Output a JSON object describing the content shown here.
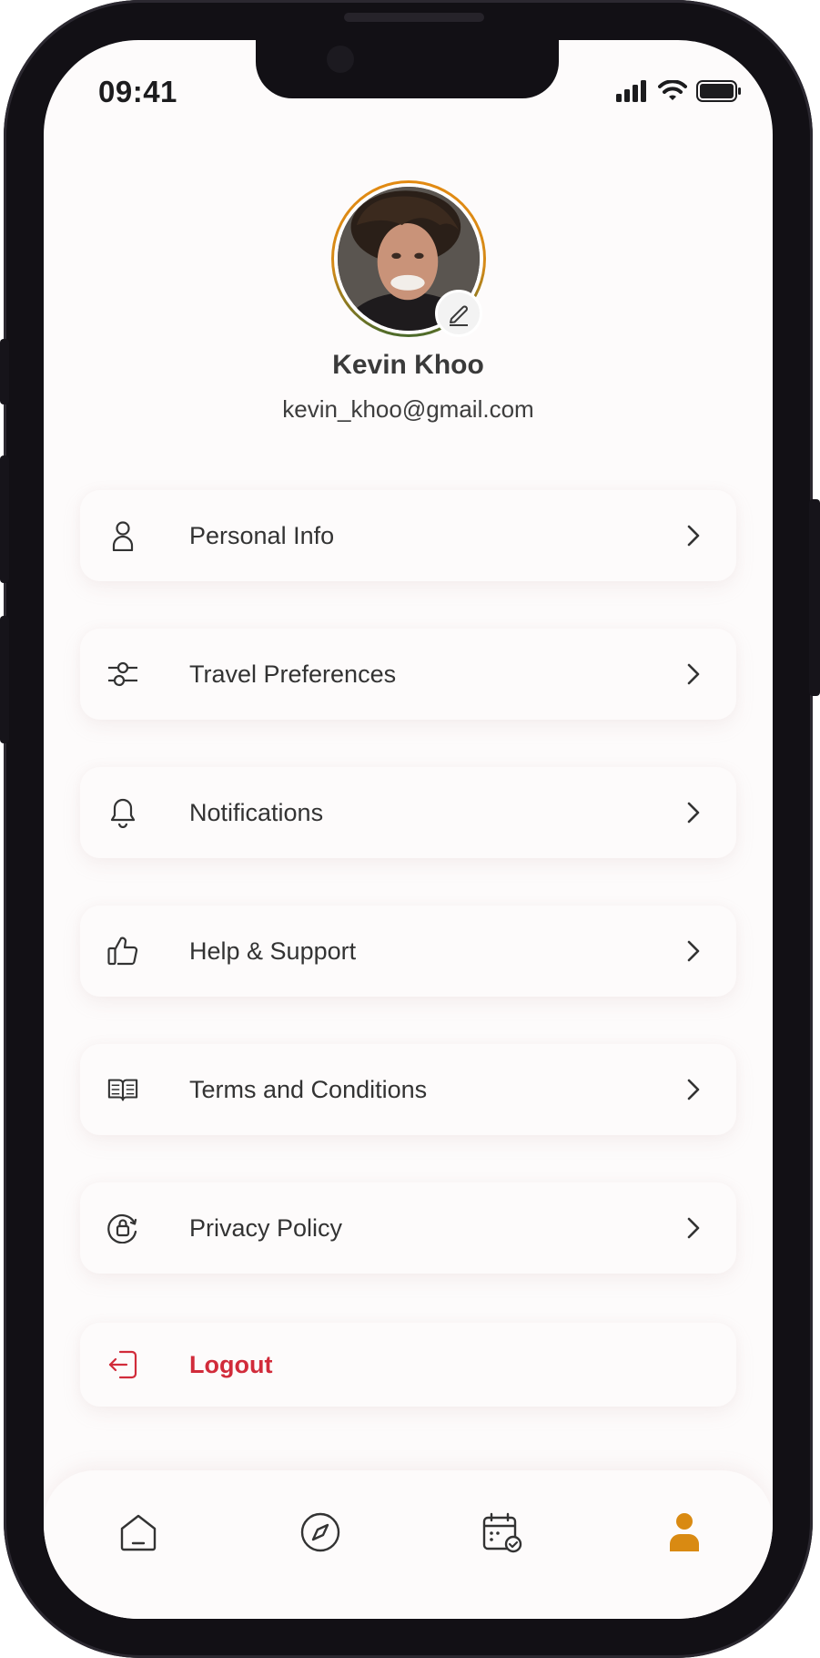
{
  "status_bar": {
    "time": "09:41"
  },
  "profile": {
    "name": "Kevin Khoo",
    "email": "kevin_khoo@gmail.com",
    "edit_icon": "pencil-icon"
  },
  "menu": {
    "items": [
      {
        "label": "Personal Info",
        "icon": "user-icon"
      },
      {
        "label": "Travel Preferences",
        "icon": "sliders-icon"
      },
      {
        "label": "Notifications",
        "icon": "bell-icon"
      },
      {
        "label": "Help & Support",
        "icon": "thumbs-up-icon"
      },
      {
        "label": "Terms and Conditions",
        "icon": "book-icon"
      },
      {
        "label": "Privacy Policy",
        "icon": "lock-icon"
      }
    ],
    "logout": {
      "label": "Logout",
      "icon": "logout-icon"
    }
  },
  "tab_bar": {
    "tabs": [
      {
        "icon": "home-icon",
        "active": false
      },
      {
        "icon": "compass-icon",
        "active": false
      },
      {
        "icon": "calendar-check-icon",
        "active": false
      },
      {
        "icon": "profile-icon",
        "active": true
      }
    ]
  },
  "colors": {
    "accent": "#d98a12",
    "danger": "#d12b3a",
    "text": "#333333",
    "background": "#fdfbfb",
    "frame": "#121015"
  }
}
